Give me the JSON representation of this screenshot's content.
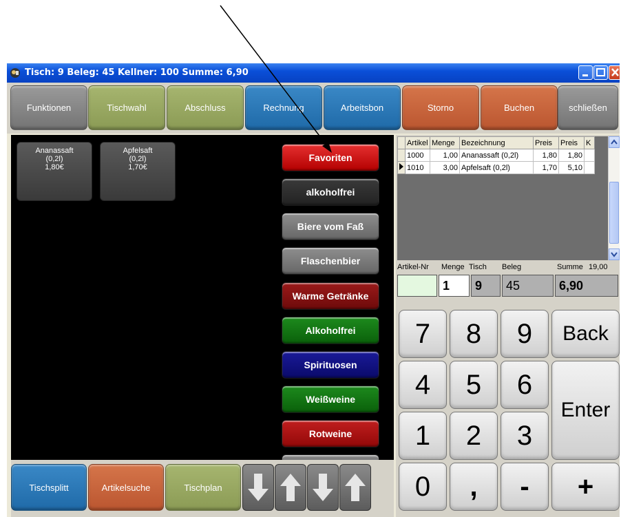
{
  "window": {
    "title": "Tisch: 9  Beleg: 45  Kellner: 100  Summe: 6,90"
  },
  "toolbar": [
    {
      "label": "Funktionen",
      "color": "#858585"
    },
    {
      "label": "Tischwahl",
      "color": "#97a762"
    },
    {
      "label": "Abschluss",
      "color": "#97a762"
    },
    {
      "label": "Rechnung",
      "color": "#2a78b8"
    },
    {
      "label": "Arbeitsbon",
      "color": "#2a78b8"
    },
    {
      "label": "Storno",
      "color": "#c8633c"
    },
    {
      "label": "Buchen",
      "color": "#c8633c"
    },
    {
      "label": "schließen",
      "color": "#858585"
    }
  ],
  "articles": [
    {
      "name": "Ananassaft",
      "size": "(0,2l)",
      "price": "1,80€"
    },
    {
      "name": "Apfelsaft",
      "size": "(0,2l)",
      "price": "1,70€"
    }
  ],
  "categories": [
    {
      "label": "Favoriten",
      "color": "#cc1111"
    },
    {
      "label": "alkoholfrei",
      "color": "#2e2e2e"
    },
    {
      "label": "Biere vom Faß",
      "color": "#7a7a7a"
    },
    {
      "label": "Flaschenbier",
      "color": "#7a7a7a"
    },
    {
      "label": "Warme Getränke",
      "color": "#801010"
    },
    {
      "label": "Alkoholfrei",
      "color": "#127512"
    },
    {
      "label": "Spirituosen",
      "color": "#121281"
    },
    {
      "label": "Weißweine",
      "color": "#127512"
    },
    {
      "label": "Rotweine",
      "color": "#a81111"
    }
  ],
  "bottom": [
    {
      "label": "Tischsplitt",
      "color": "#2a78b8"
    },
    {
      "label": "Artikelsuche",
      "color": "#c8633c"
    },
    {
      "label": "Tischplan",
      "color": "#97a762"
    }
  ],
  "arrow_icons": [
    "arrow-down-icon",
    "arrow-up-icon",
    "arrow-down-icon",
    "arrow-up-icon"
  ],
  "order_grid": {
    "columns": [
      "Artikel",
      "Menge",
      "Bezeichnung",
      "Preis",
      "Preis",
      "K"
    ],
    "rows": [
      {
        "artikel": "1000",
        "menge": "1,00",
        "bezeichnung": "Ananassaft (0,2l)",
        "preis": "1,80",
        "preis_total": "1,80",
        "k": ""
      },
      {
        "artikel": "1010",
        "menge": "3,00",
        "bezeichnung": "Apfelsaft (0,2l)",
        "preis": "1,70",
        "preis_total": "5,10",
        "k": ""
      }
    ],
    "selected_row": 1
  },
  "info": {
    "labels": {
      "artikel_nr": "Artikel-Nr",
      "menge": "Menge",
      "tisch": "Tisch",
      "beleg": "Beleg",
      "summe": "Summe",
      "summe_total": "19,00"
    },
    "values": {
      "artikel_nr": "",
      "menge": "1",
      "tisch": "9",
      "beleg": "45",
      "summe": "6,90"
    }
  },
  "keypad": {
    "digits": [
      "7",
      "8",
      "9",
      "4",
      "5",
      "6",
      "1",
      "2",
      "3",
      "0"
    ],
    "comma": ",",
    "minus": "-",
    "plus": "+",
    "back": "Back",
    "enter": "Enter"
  }
}
